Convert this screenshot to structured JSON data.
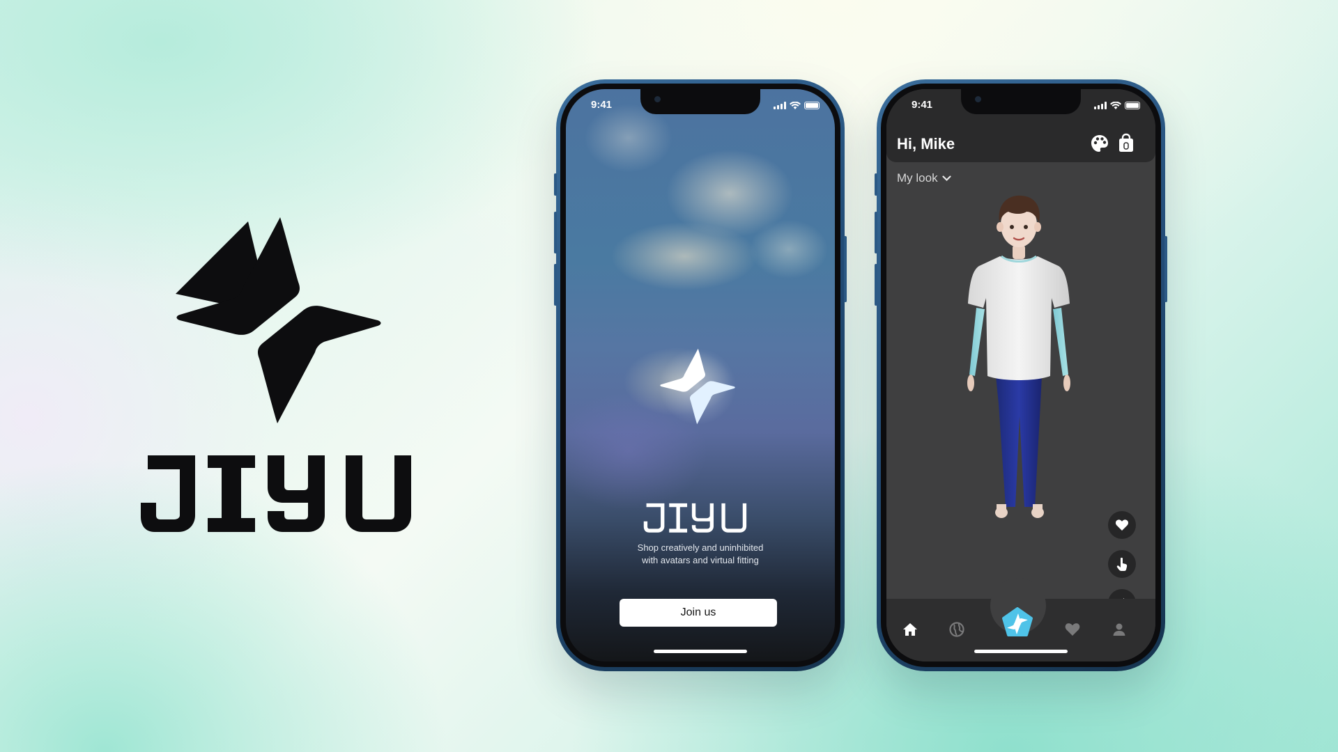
{
  "brand": {
    "wordmark": "JIYU"
  },
  "phone1": {
    "status_time": "9:41",
    "wordmark": "JIYU",
    "tagline_line1": "Shop creatively and uninhibited",
    "tagline_line2": "with avatars and virtual fitting",
    "join_label": "Join us"
  },
  "phone2": {
    "status_time": "9:41",
    "greeting": "Hi, Mike",
    "look_select": "My look",
    "header_icons": [
      "palette-icon",
      "shopping-bag-icon"
    ],
    "actions": [
      "heart-icon",
      "tap-hand-icon",
      "share-arrow-icon"
    ],
    "tabs": [
      {
        "icon": "home-icon",
        "active": true
      },
      {
        "icon": "globe-icon",
        "active": false
      },
      {
        "icon": "star-logo-icon",
        "active": false
      },
      {
        "icon": "heart-icon",
        "active": false
      },
      {
        "icon": "profile-icon",
        "active": false
      }
    ]
  },
  "colors": {
    "accent": "#4fc3e8",
    "dark_surface": "#2a2a2b",
    "app_background": "#3f3f40"
  }
}
